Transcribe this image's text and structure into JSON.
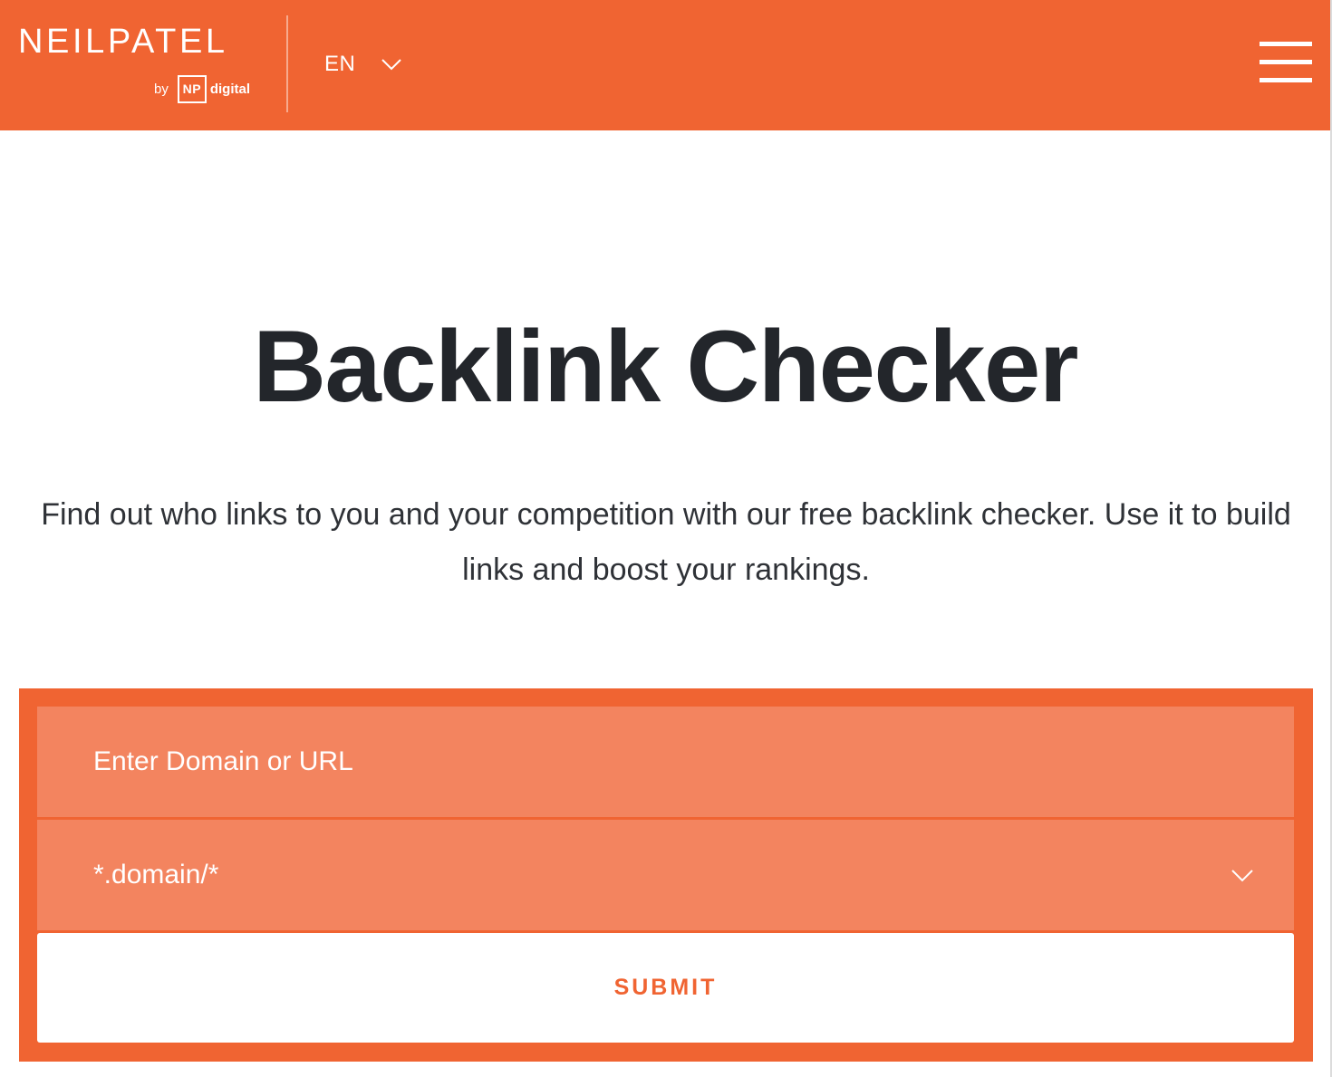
{
  "brand": {
    "wordmark": "NEILPATEL",
    "by": "by",
    "np": "NP",
    "digital": "digital",
    "accent_color": "#f06432",
    "field_color": "#f3845f",
    "text_color": "#23262b"
  },
  "header": {
    "language": "EN",
    "language_icon": "chevron-down-icon",
    "menu_icon": "hamburger-menu-icon"
  },
  "hero": {
    "title": "Backlink Checker",
    "subtitle": "Find out who links to you and your competition with our free backlink checker. Use it to build links and boost your rankings."
  },
  "form": {
    "url_placeholder": "Enter Domain or URL",
    "scope_selected": "*.domain/*",
    "scope_icon": "chevron-down-icon",
    "submit_label": "SUBMIT"
  }
}
